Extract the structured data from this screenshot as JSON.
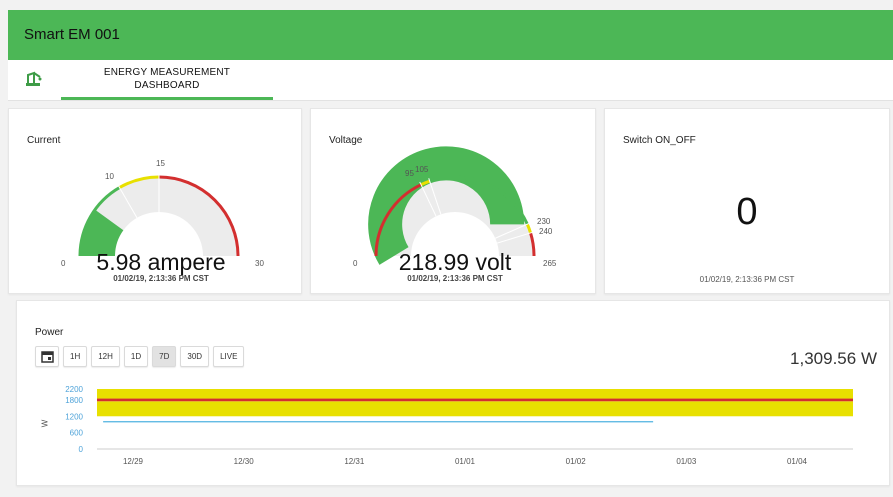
{
  "app": {
    "title": "Smart EM 001"
  },
  "tabs": [
    {
      "icon": "crane-icon",
      "label_line1": "ENERGY MEASUREMENT",
      "label_line2": "DASHBOARD"
    }
  ],
  "colors": {
    "brand": "#4cb756",
    "gauge_red": "#d32f2f",
    "gauge_yellow": "#e8e000",
    "gauge_green": "#4cb756",
    "track": "#ececec",
    "line": "#4fb3e0"
  },
  "current": {
    "title": "Current",
    "value": 5.98,
    "display": "5.98 ampere",
    "timestamp": "01/02/19, 2:13:36 PM CST",
    "min_label": "0",
    "max_label": "30",
    "tick_10": "10",
    "tick_15": "15",
    "min": 0,
    "max": 30,
    "bands": [
      {
        "from": 0,
        "to": 10,
        "color": "green"
      },
      {
        "from": 10,
        "to": 15,
        "color": "yellow"
      },
      {
        "from": 15,
        "to": 30,
        "color": "red"
      }
    ]
  },
  "voltage": {
    "title": "Voltage",
    "value": 218.99,
    "display": "218.99 volt",
    "timestamp": "01/02/19, 2:13:36 PM CST",
    "min_label": "0",
    "max_label": "265",
    "tick_95": "95",
    "tick_105": "105",
    "tick_230": "230",
    "tick_240": "240",
    "min": 0,
    "max": 265,
    "bands": [
      {
        "from": 0,
        "to": 95,
        "color": "red"
      },
      {
        "from": 95,
        "to": 105,
        "color": "yellow"
      },
      {
        "from": 105,
        "to": 230,
        "color": "green"
      },
      {
        "from": 230,
        "to": 240,
        "color": "yellow"
      },
      {
        "from": 240,
        "to": 265,
        "color": "red"
      }
    ]
  },
  "switch": {
    "title": "Switch ON_OFF",
    "value": "0",
    "timestamp": "01/02/19, 2:13:36 PM CST"
  },
  "power": {
    "title": "Power",
    "value": "1,309.56 W",
    "calendar_icon": "calendar-icon",
    "ranges": [
      {
        "label": "1H",
        "active": false
      },
      {
        "label": "12H",
        "active": false
      },
      {
        "label": "1D",
        "active": false
      },
      {
        "label": "7D",
        "active": true
      },
      {
        "label": "30D",
        "active": false
      },
      {
        "label": "LIVE",
        "active": false
      }
    ]
  },
  "chart_data": {
    "type": "line",
    "ylabel": "W",
    "y_ticks": [
      "0",
      "600",
      "1200",
      "1800",
      "2200"
    ],
    "ylim": [
      0,
      2200
    ],
    "x_ticks": [
      "12/29",
      "12/30",
      "12/31",
      "01/01",
      "01/02",
      "01/03",
      "01/04"
    ],
    "bands": [
      {
        "from": 1200,
        "to": 1750,
        "color": "#e8e000"
      },
      {
        "from": 1750,
        "to": 1850,
        "color": "#d32f2f"
      },
      {
        "from": 1850,
        "to": 2200,
        "color": "#e8e000"
      }
    ],
    "series": [
      {
        "values": [
          1000,
          1000,
          1000,
          1000,
          1000,
          1000
        ],
        "x": [
          "12/29",
          "12/30",
          "12/31",
          "01/01",
          "01/02",
          "01/02"
        ]
      }
    ],
    "grid": false
  }
}
